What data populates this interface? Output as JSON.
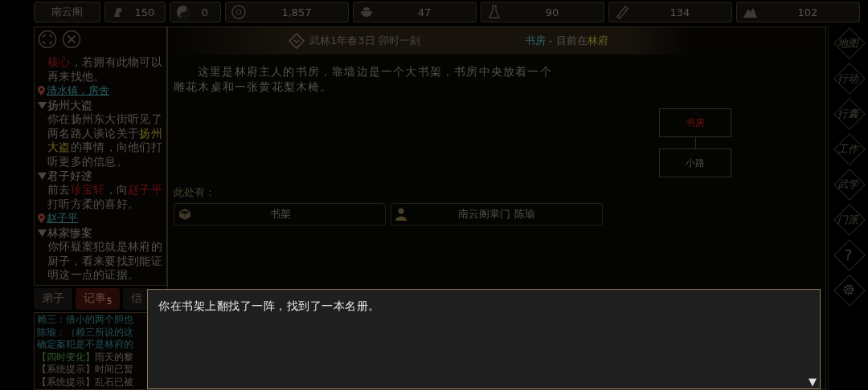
{
  "top_bar": {
    "sect": "南云阁",
    "stats": [
      {
        "value": "150"
      },
      {
        "value": "0"
      },
      {
        "value": "1,857"
      },
      {
        "value": "47"
      },
      {
        "value": "90"
      },
      {
        "value": "134"
      },
      {
        "value": "102"
      }
    ]
  },
  "quest_log": [
    {
      "kind": "description",
      "segments": [
        {
          "kind": "key",
          "text": "核心"
        },
        {
          "kind": "plain",
          "text": "，若拥有此物可以再来找他。"
        }
      ]
    },
    {
      "kind": "location",
      "text": "清水镇，房舍"
    },
    {
      "kind": "quest",
      "title": "扬州大盗",
      "expanded": true
    },
    {
      "kind": "description",
      "segments": [
        {
          "kind": "plain",
          "text": "你在扬州东大街听见了两名路人谈论关于"
        },
        {
          "kind": "highlight",
          "text": "扬州大盗"
        },
        {
          "kind": "plain",
          "text": "的事情，向他们打听更多的信息。"
        }
      ]
    },
    {
      "kind": "quest",
      "title": "君子好逑",
      "expanded": true
    },
    {
      "kind": "description",
      "segments": [
        {
          "kind": "plain",
          "text": "前去"
        },
        {
          "kind": "key",
          "text": "珍宝轩"
        },
        {
          "kind": "plain",
          "text": "，向"
        },
        {
          "kind": "key",
          "text": "赵子平"
        },
        {
          "kind": "plain",
          "text": "打听方柔的喜好。"
        }
      ]
    },
    {
      "kind": "location",
      "text": "赵子平"
    },
    {
      "kind": "quest",
      "title": "林家惨案",
      "expanded": true
    },
    {
      "kind": "description",
      "segments": [
        {
          "kind": "plain",
          "text": "你怀疑案犯就是林府的厨子，看来要找到能证明这一点的证据。"
        }
      ]
    }
  ],
  "tabs": [
    {
      "label": "弟子",
      "selected": false
    },
    {
      "label": "记事",
      "badge": "5",
      "selected": true
    },
    {
      "label": "信",
      "selected": false
    }
  ],
  "message_log": [
    {
      "segments": [
        {
          "kind": "dialogue",
          "text": "赖三：借小的两个胆也"
        }
      ]
    },
    {
      "segments": [
        {
          "kind": "dialogue",
          "text": "陈瑜：（赖三所说的这"
        }
      ]
    },
    {
      "segments": [
        {
          "kind": "dialogue",
          "text": "确定案犯是不是林府的"
        }
      ]
    },
    {
      "segments": [
        {
          "kind": "event",
          "text": "【四时变化】"
        },
        {
          "kind": "plain",
          "text": "雨天的黎"
        }
      ]
    },
    {
      "segments": [
        {
          "kind": "plain",
          "text": "【系统提示】时间已暂"
        }
      ]
    },
    {
      "segments": [
        {
          "kind": "plain",
          "text": "【系统提示】乱石已被"
        }
      ]
    }
  ],
  "header": {
    "date": "武林1年春3日 卯时一刻",
    "location": [
      {
        "kind": "room",
        "text": "书房"
      },
      {
        "kind": "plain",
        "text": " - 目前在"
      },
      {
        "kind": "highlight",
        "text": "林府"
      }
    ]
  },
  "description": "这里是林府主人的书房，靠墙边是一个大书架，书房中央放着一个雕花木桌和一张黄花梨木椅。",
  "map": [
    {
      "label": "书房",
      "current": true
    },
    {
      "label": "小路",
      "current": false
    }
  ],
  "here": {
    "label": "此处有：",
    "entries": [
      {
        "kind": "object",
        "label": "书架"
      },
      {
        "kind": "person",
        "label": "南云阁掌门 陈瑜"
      }
    ]
  },
  "side_menu": [
    {
      "kind": "text",
      "label": "地图"
    },
    {
      "kind": "text",
      "label": "行动"
    },
    {
      "kind": "text",
      "label": "行囊"
    },
    {
      "kind": "text",
      "label": "工作"
    },
    {
      "kind": "text",
      "label": "武学"
    },
    {
      "kind": "text",
      "label": "门派"
    },
    {
      "kind": "text",
      "label": "?"
    },
    {
      "kind": "settings"
    }
  ],
  "dialog": {
    "text": "你在书架上翻找了一阵，找到了一本名册。",
    "more": "▼"
  }
}
